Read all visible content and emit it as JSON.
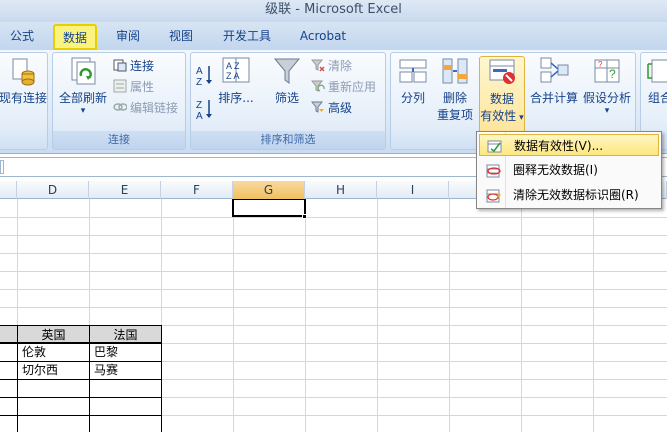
{
  "window": {
    "title": "级联 - Microsoft Excel"
  },
  "tabs": [
    {
      "label": "公式"
    },
    {
      "label": "数据"
    },
    {
      "label": "审阅"
    },
    {
      "label": "视图"
    },
    {
      "label": "开发工具"
    },
    {
      "label": "Acrobat"
    }
  ],
  "ribbon": {
    "existing_conn": "现有连接",
    "refresh_all": "全部刷新",
    "connections": "连接",
    "properties": "属性",
    "edit_links": "编辑链接",
    "group_connections": "连接",
    "sort": "排序...",
    "filter": "筛选",
    "clear": "清除",
    "reapply": "重新应用",
    "advanced": "高级",
    "group_sortfilter": "排序和筛选",
    "split": "分列",
    "remove_dup_1": "删除",
    "remove_dup_2": "重复项",
    "data_valid_1": "数据",
    "data_valid_2": "有效性",
    "consolidate": "合并计算",
    "whatif": "假设分析",
    "group_more": "组合",
    "sort_az": "A Z",
    "sort_za": "Z A"
  },
  "dropdown": {
    "items": [
      {
        "label": "数据有效性(V)..."
      },
      {
        "label": "圈释无效数据(I)"
      },
      {
        "label": "清除无效数据标识圈(R)"
      }
    ]
  },
  "columns": [
    "D",
    "E",
    "F",
    "G",
    "H",
    "I"
  ],
  "table": {
    "headers": [
      "英国",
      "法国"
    ],
    "rows": [
      [
        "伦敦",
        "巴黎"
      ],
      [
        "切尔西",
        "马赛"
      ]
    ]
  },
  "colors": {
    "accent": "#15428b",
    "highlight": "#fde77e",
    "selected_col": "#f1c15f"
  }
}
